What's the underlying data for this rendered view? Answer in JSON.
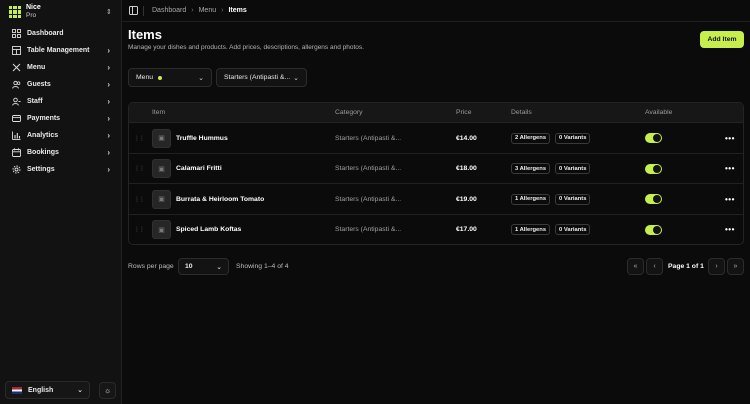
{
  "brand": {
    "name": "Nice",
    "sub": "Pro"
  },
  "sidebar": {
    "items": [
      {
        "label": "Dashboard",
        "icon": "dashboard-grid-icon",
        "has_chevron": false
      },
      {
        "label": "Table Management",
        "icon": "table-icon",
        "has_chevron": true
      },
      {
        "label": "Menu",
        "icon": "utensils-icon",
        "has_chevron": true
      },
      {
        "label": "Guests",
        "icon": "users-icon",
        "has_chevron": true
      },
      {
        "label": "Staff",
        "icon": "user-badge-icon",
        "has_chevron": true
      },
      {
        "label": "Payments",
        "icon": "credit-card-icon",
        "has_chevron": true
      },
      {
        "label": "Analytics",
        "icon": "bar-chart-icon",
        "has_chevron": true
      },
      {
        "label": "Bookings",
        "icon": "calendar-icon",
        "has_chevron": true
      },
      {
        "label": "Settings",
        "icon": "gear-icon",
        "has_chevron": true
      }
    ],
    "language": "English"
  },
  "breadcrumb": [
    "Dashboard",
    "Menu",
    "Items"
  ],
  "page": {
    "title": "Items",
    "description": "Manage your dishes and products. Add prices, descriptions, allergens and photos.",
    "add_button": "Add Item"
  },
  "filters": {
    "menu": "Menu",
    "category": "Starters (Antipasti &..."
  },
  "table": {
    "headers": {
      "item": "Item",
      "category": "Category",
      "price": "Price",
      "details": "Details",
      "available": "Available"
    },
    "rows": [
      {
        "name": "Truffle Hummus",
        "category": "Starters (Antipasti &...",
        "price": "€14.00",
        "allergens": "2 Allergens",
        "variants": "0 Variants",
        "available": true
      },
      {
        "name": "Calamari Fritti",
        "category": "Starters (Antipasti &...",
        "price": "€18.00",
        "allergens": "3 Allergens",
        "variants": "0 Variants",
        "available": true
      },
      {
        "name": "Burrata & Heirloom Tomato",
        "category": "Starters (Antipasti &...",
        "price": "€19.00",
        "allergens": "1 Allergens",
        "variants": "0 Variants",
        "available": true
      },
      {
        "name": "Spiced Lamb Koftas",
        "category": "Starters (Antipasti &...",
        "price": "€17.00",
        "allergens": "1 Allergens",
        "variants": "0 Variants",
        "available": true
      }
    ]
  },
  "pagination": {
    "rows_per_page_label": "Rows per page",
    "rows_per_page_value": "10",
    "showing": "Showing 1–4 of 4",
    "page_label": "Page 1 of 1"
  },
  "colors": {
    "accent": "#c6ef4e",
    "background": "#0b0b0b",
    "sidebar": "#121212"
  }
}
